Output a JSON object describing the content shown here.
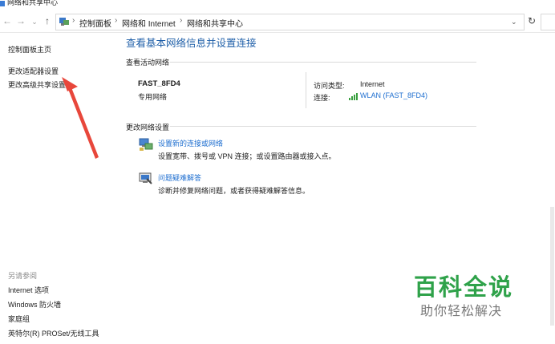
{
  "window": {
    "title": "网络和共享中心"
  },
  "address_bar": {
    "crumbs": [
      "控制面板",
      "网络和 Internet",
      "网络和共享中心"
    ]
  },
  "left_pane": {
    "links": [
      "控制面板主页",
      "更改适配器设置",
      "更改高级共享设置"
    ],
    "see_also_heading": "另请参阅",
    "see_also": [
      "Internet 选项",
      "Windows 防火墙",
      "家庭组",
      "英特尔(R) PROSet/无线工具"
    ]
  },
  "main": {
    "title": "查看基本网络信息并设置连接",
    "active_networks_heading": "查看活动网络",
    "network": {
      "name": "FAST_8FD4",
      "category": "专用网络",
      "access_type_label": "访问类型:",
      "access_type_value": "Internet",
      "connections_label": "连接:",
      "connections_value": "WLAN (FAST_8FD4)"
    },
    "change_settings_heading": "更改网络设置",
    "tasks": [
      {
        "link": "设置新的连接或网络",
        "desc": "设置宽带、拨号或 VPN 连接；或设置路由器或接入点。",
        "icon": "new-connection-icon"
      },
      {
        "link": "问题疑难解答",
        "desc": "诊断并修复网络问题，或者获得疑难解答信息。",
        "icon": "troubleshoot-icon"
      }
    ]
  },
  "watermark": {
    "title": "百科全说",
    "subtitle": "助你轻松解决"
  },
  "colors": {
    "link": "#1f6fd0",
    "title": "#1f5fa8",
    "annotation_arrow": "#e8473b",
    "watermark": "#2fa24a"
  }
}
